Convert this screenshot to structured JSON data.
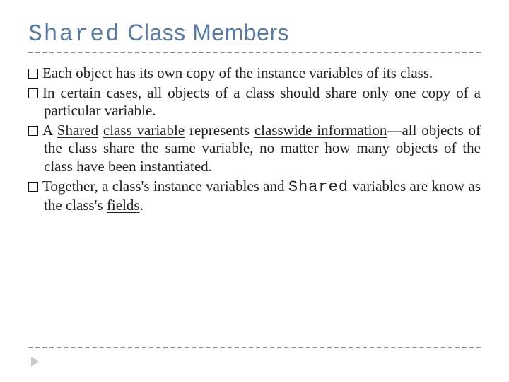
{
  "title": {
    "code_word": "Shared",
    "rest": " Class Members"
  },
  "bullets": {
    "b1": "Each object has its own copy of the instance variables of its class.",
    "b2": "In certain cases, all objects of a class should share only one copy of a particular variable.",
    "b3": {
      "pre": "A ",
      "u1": "Shared",
      "mid1": " ",
      "u2": "class variable",
      "mid2": " represents ",
      "u3": "classwide information",
      "post": "—all objects of the class share the same variable, no matter how many objects of the class have been instantiated."
    },
    "b4": {
      "pre": "Together, a class's instance variables and ",
      "code": "Shared",
      "mid": " variables are know as the class's ",
      "u": "fields",
      "post": "."
    }
  }
}
